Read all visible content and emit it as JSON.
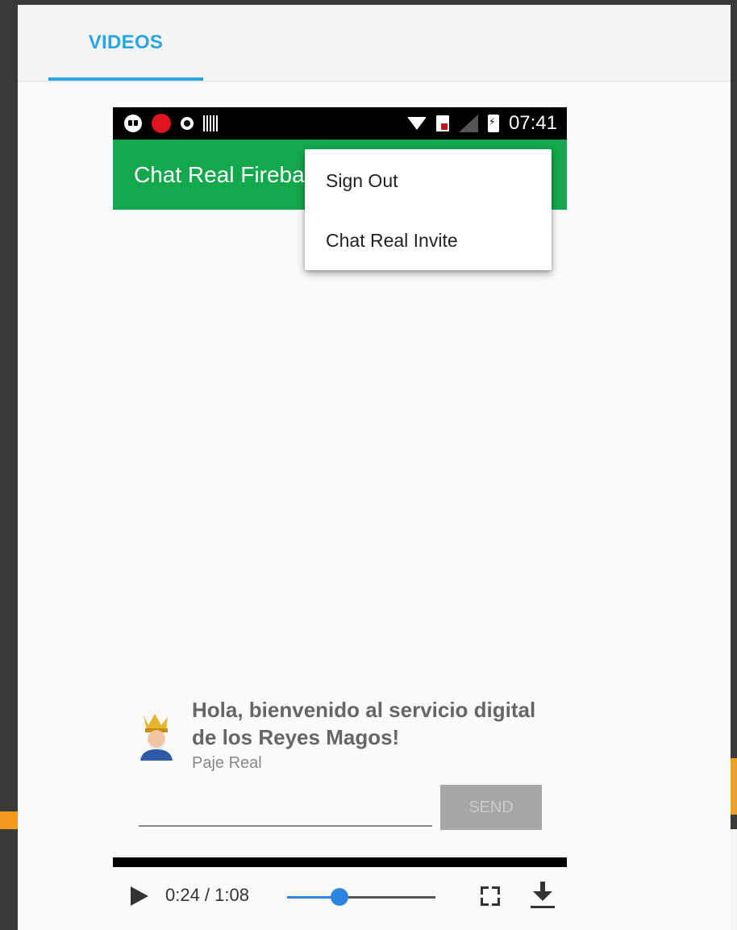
{
  "tabs": [
    {
      "label": "VIDEOS",
      "active": true
    }
  ],
  "status_bar": {
    "time": "07:41"
  },
  "app": {
    "title": "Chat Real Firebase",
    "accent": "#14a84c"
  },
  "menu": {
    "items": [
      {
        "label": "Sign Out"
      },
      {
        "label": "Chat Real Invite"
      }
    ]
  },
  "chat": {
    "message": "Hola, bienvenido al servicio digital de los Reyes Magos!",
    "author": "Paje Real"
  },
  "composer": {
    "send_label": "SEND"
  },
  "player": {
    "time_display": "0:24 / 1:08",
    "progress_fraction": 0.353
  },
  "colors": {
    "tab_accent": "#2aa6e0",
    "slider": "#2a86e0",
    "send_disabled": "#a7a7a7"
  }
}
